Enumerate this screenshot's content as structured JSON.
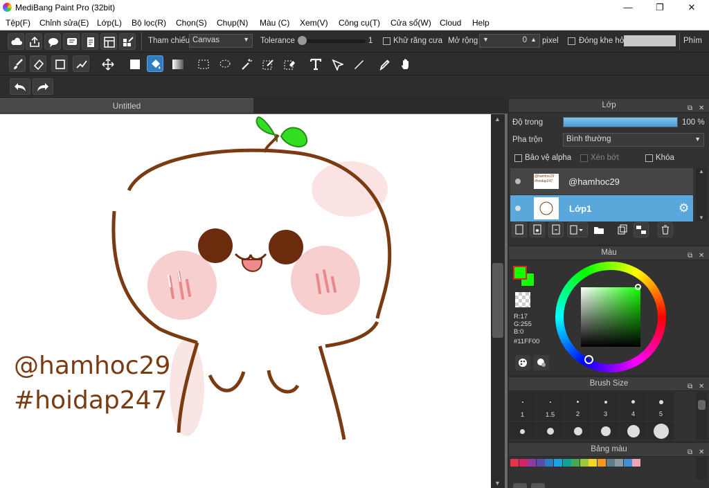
{
  "window": {
    "title": "MediBang Paint Pro (32bit)",
    "minimize": "—",
    "maximize": "❐",
    "close": "✕"
  },
  "menu": [
    "Tệp(F)",
    "Chỉnh sửa(E)",
    "Lớp(L)",
    "Bộ lọc(R)",
    "Chọn(S)",
    "Chụp(N)",
    "Màu (C)",
    "Xem(V)",
    "Công cụ(T)",
    "Cửa sổ(W)",
    "Cloud",
    "Help"
  ],
  "toolbar": {
    "reference_label": "Tham chiếu",
    "reference_value": "Canvas",
    "tolerance_label": "Tolerance",
    "tolerance_value": "1",
    "antialias_label": "Khử răng cưa",
    "expand_label": "Mở rộng",
    "expand_value": "0",
    "expand_unit": "pixel",
    "close_gap_label": "Đóng khe hở",
    "shortcut_label": "Phím"
  },
  "document": {
    "tab": "Untitled"
  },
  "canvas_art": {
    "text_line1": "@hamhoc29",
    "text_line2": "#hoidap247",
    "thumb_text": "@hamhoc29 #hoidap247"
  },
  "layer_panel": {
    "title": "Lớp",
    "opacity_label": "Độ trong",
    "opacity_value": "100 %",
    "opacity_fraction": 1.0,
    "blend_label": "Pha trộn",
    "blend_value": "Bình thường",
    "protect_alpha": "Bảo vệ alpha",
    "clipping": "Xén bớt",
    "lock": "Khóa",
    "layers": [
      {
        "name": "@hamhoc29",
        "selected": false
      },
      {
        "name": "Lớp1",
        "selected": true
      }
    ]
  },
  "color_panel": {
    "title": "Màu",
    "r": "R:17",
    "g": "G:255",
    "b": "B:0",
    "hex": "#11FF00",
    "fg": "#11ff00",
    "bg": "#11ff00"
  },
  "brush_panel": {
    "title": "Brush Size",
    "sizes": [
      "1",
      "1.5",
      "2",
      "3",
      "4",
      "5"
    ]
  },
  "palette_panel": {
    "title": "Bảng màu",
    "swatches": [
      "#e8344a",
      "#d6226b",
      "#8e3a9e",
      "#5b4aa8",
      "#2e7ec4",
      "#19a6e3",
      "#0fa39a",
      "#49a84e",
      "#9bc83c",
      "#f1d728",
      "#f59a1b",
      "#5e7d8a",
      "#8c9aa2",
      "#3e8fd4",
      "#f0a3b8"
    ]
  }
}
